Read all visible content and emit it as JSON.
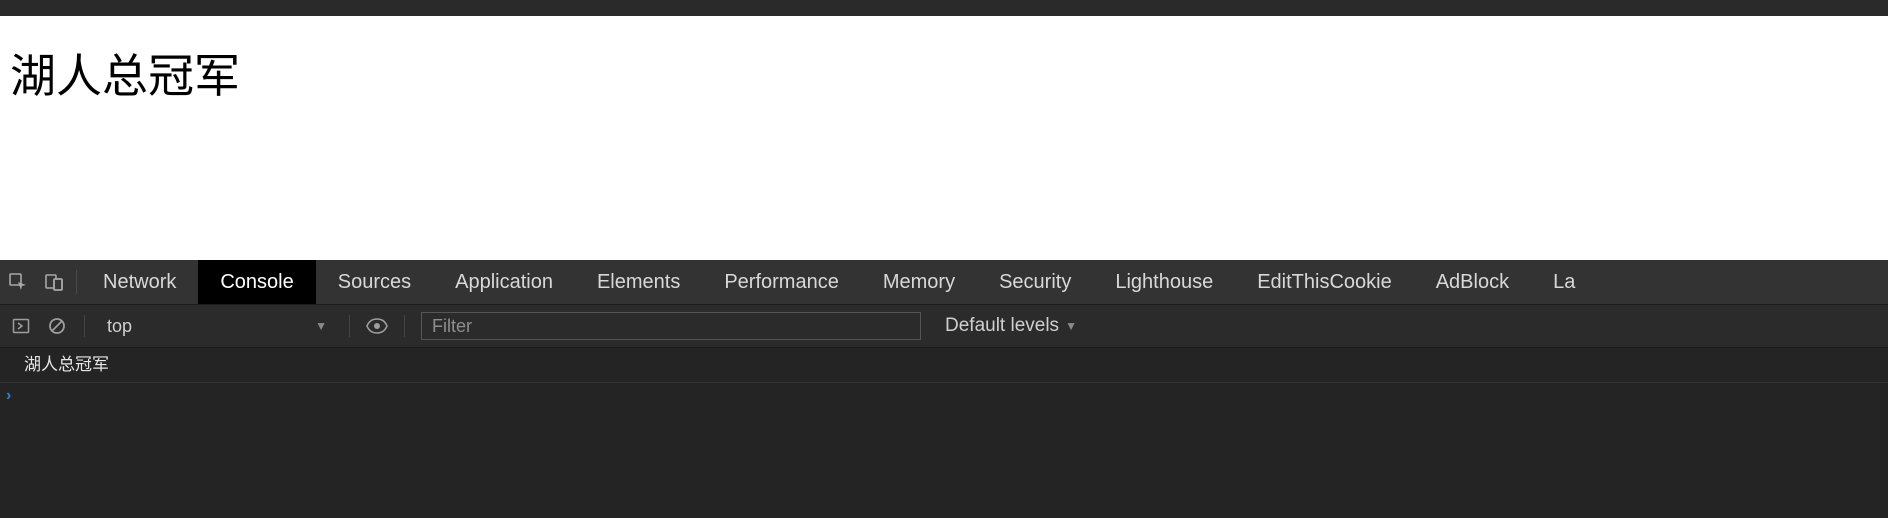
{
  "page": {
    "heading": "湖人总冠军"
  },
  "devtools": {
    "tabs": [
      "Network",
      "Console",
      "Sources",
      "Application",
      "Elements",
      "Performance",
      "Memory",
      "Security",
      "Lighthouse",
      "EditThisCookie",
      "AdBlock",
      "La"
    ],
    "active_tab_index": 1,
    "console": {
      "context": "top",
      "filter_placeholder": "Filter",
      "levels_label": "Default levels",
      "log_lines": [
        "湖人总冠军"
      ]
    }
  }
}
